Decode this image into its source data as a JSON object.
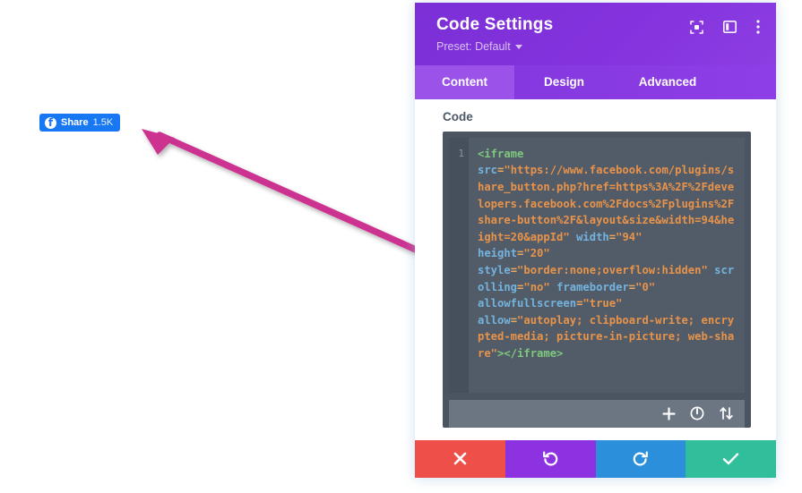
{
  "share_button": {
    "icon": "facebook-icon",
    "glyph": "f",
    "label": "Share",
    "count": "1.5K",
    "color": "#1877f2"
  },
  "annotation": {
    "name": "pink-arrow-annotation",
    "color": "#cc3390",
    "description": "Arrow pointing from code editor to the Facebook share button"
  },
  "modal": {
    "title": "Code Settings",
    "preset_label": "Preset: Default",
    "header_color": "#7a2fd4",
    "header_icons": [
      {
        "name": "focus-view-icon",
        "label": "Focus view"
      },
      {
        "name": "layout-columns-icon",
        "label": "Layout"
      },
      {
        "name": "more-options-icon",
        "label": "More options"
      }
    ],
    "tabs": [
      {
        "label": "Content",
        "active": true
      },
      {
        "label": "Design",
        "active": false
      },
      {
        "label": "Advanced",
        "active": false
      }
    ],
    "field": {
      "label": "Code",
      "line_number": "1",
      "code_tokens": [
        {
          "t": "tag",
          "v": "<iframe"
        },
        {
          "t": "text",
          "v": "\n"
        },
        {
          "t": "attr",
          "v": "src"
        },
        {
          "t": "text",
          "v": "="
        },
        {
          "t": "val",
          "v": "\"https://www.facebook.com/plugins/share_button.php?href=https%3A%2F%2Fdevelopers.facebook.com%2Fdocs%2Fplugins%2Fshare-button%2F&layout&size&width=94&height=20&appId\""
        },
        {
          "t": "text",
          "v": " "
        },
        {
          "t": "attr",
          "v": "width"
        },
        {
          "t": "text",
          "v": "="
        },
        {
          "t": "val",
          "v": "\"94\""
        },
        {
          "t": "text",
          "v": "\n"
        },
        {
          "t": "attr",
          "v": "height"
        },
        {
          "t": "text",
          "v": "="
        },
        {
          "t": "val",
          "v": "\"20\""
        },
        {
          "t": "text",
          "v": "\n"
        },
        {
          "t": "attr",
          "v": "style"
        },
        {
          "t": "text",
          "v": "="
        },
        {
          "t": "val",
          "v": "\"border:none;overflow:hidden\""
        },
        {
          "t": "text",
          "v": " "
        },
        {
          "t": "attr",
          "v": "scrolling"
        },
        {
          "t": "text",
          "v": "="
        },
        {
          "t": "val",
          "v": "\"no\""
        },
        {
          "t": "text",
          "v": " "
        },
        {
          "t": "attr",
          "v": "frameborder"
        },
        {
          "t": "text",
          "v": "="
        },
        {
          "t": "val",
          "v": "\"0\""
        },
        {
          "t": "text",
          "v": "\n"
        },
        {
          "t": "attr",
          "v": "allowfullscreen"
        },
        {
          "t": "text",
          "v": "="
        },
        {
          "t": "val",
          "v": "\"true\""
        },
        {
          "t": "text",
          "v": "\n"
        },
        {
          "t": "attr",
          "v": "allow"
        },
        {
          "t": "text",
          "v": "="
        },
        {
          "t": "val",
          "v": "\"autoplay; clipboard-write; encrypted-media; picture-in-picture; web-share\""
        },
        {
          "t": "tag",
          "v": "></iframe>"
        }
      ],
      "code_plain": "<iframe src=\"https://www.facebook.com/plugins/share_button.php?href=https%3A%2F%2Fdevelopers.facebook.com%2Fdocs%2Fplugins%2Fshare-button%2F&layout&size&width=94&height=20&appId\" width=\"94\" height=\"20\" style=\"border:none;overflow:hidden\" scrolling=\"no\" frameborder=\"0\" allowfullscreen=\"true\" allow=\"autoplay; clipboard-write; encrypted-media; picture-in-picture; web-share\"></iframe>"
    },
    "editor_tools": [
      {
        "name": "add-icon",
        "label": "Add"
      },
      {
        "name": "power-toggle-icon",
        "label": "Toggle"
      },
      {
        "name": "sort-updown-icon",
        "label": "Reorder"
      }
    ],
    "footer_buttons": [
      {
        "name": "cancel-button",
        "icon": "close-icon",
        "color": "#ee4f48"
      },
      {
        "name": "undo-button",
        "icon": "undo-icon",
        "color": "#8c32e0"
      },
      {
        "name": "redo-button",
        "icon": "redo-icon",
        "color": "#2b8fdb"
      },
      {
        "name": "save-button",
        "icon": "check-icon",
        "color": "#30bf9a"
      }
    ]
  }
}
